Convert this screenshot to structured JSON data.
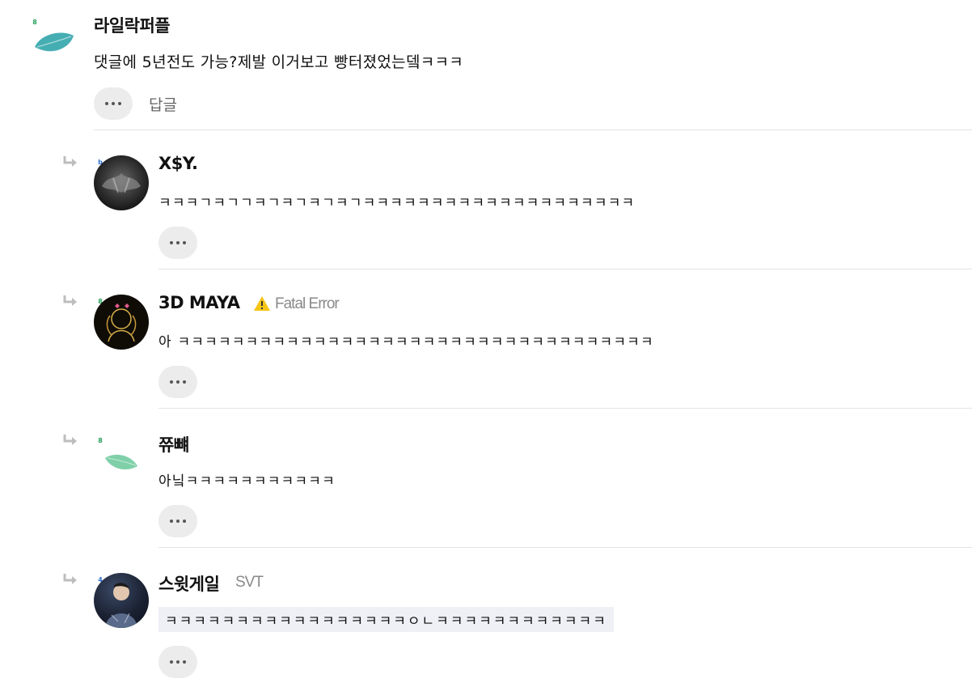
{
  "comments": [
    {
      "level": "8",
      "level_color": "#27a05a",
      "avatar_icon": "leaf-icon",
      "name": "라일락퍼플",
      "text": "댓글에 5년전도 가능?제발 이거보고 빵터졌었는뎈ㅋㅋㅋ",
      "more_label": "more-options",
      "reply_label": "답글"
    },
    {
      "level": "b",
      "level_color": "#2f6fd6",
      "name": "X$Y.",
      "text": "ㅋㅋㅋㄱㅋㄱㄱㅋㄱㅋㄱㅋㄱㅋㄱㅋㅋㅋㅋㅋㅋㅋㅋㅋㅋㅋㅋㅋㅋㅋㅋㅋㅋㅋㅋ"
    },
    {
      "level": "8",
      "level_color": "#27a05a",
      "name": "3D MAYA",
      "badge_icon": "warning-icon",
      "badge": "Fatal Error",
      "text": "아 ㅋㅋㅋㅋㅋㅋㅋㅋㅋㅋㅋㅋㅋㅋㅋㅋㅋㅋㅋㅋㅋㅋㅋㅋㅋㅋㅋㅋㅋㅋㅋㅋㅋㅋㅋ"
    },
    {
      "level": "8",
      "level_color": "#27a05a",
      "avatar_icon": "leaf-icon",
      "name": "쮸뺴",
      "text": "아닠ㅋㅋㅋㅋㅋㅋㅋㅋㅋㅋㅋ"
    },
    {
      "level": "4",
      "level_color": "#2f6fd6",
      "name": "스윗게일",
      "badge": "SVT",
      "text": "ㅋㅋㅋㅋㅋㅋㅋㅋㅋㅋㅋㅋㅋㅋㅋㅋㅋㅇㄴㅋㅋㅋㅋㅋㅋㅋㅋㅋㅋㅋㅋ"
    }
  ]
}
